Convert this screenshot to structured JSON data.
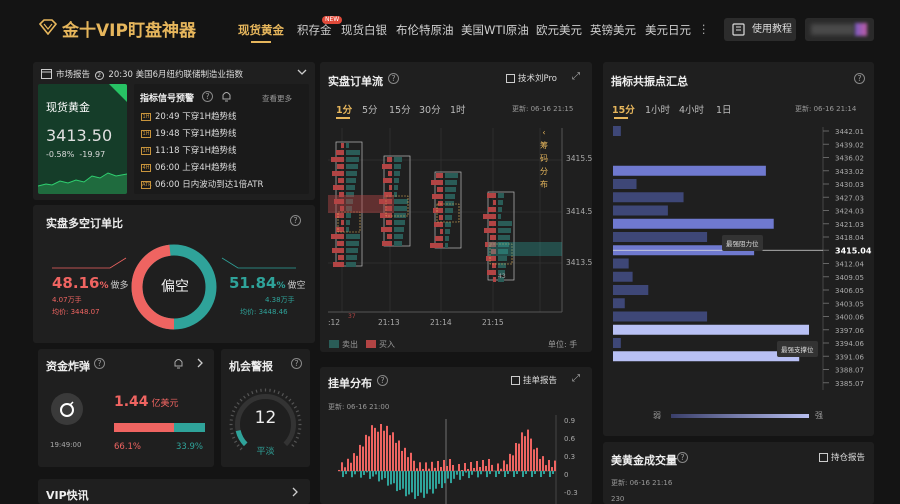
{
  "header": {
    "logo_text": "金十VIP盯盘神器",
    "nav": [
      "现货黄金",
      "积存金",
      "现货白银",
      "布伦特原油",
      "美国WTI原油",
      "欧元美元",
      "英镑美元",
      "美元日元"
    ],
    "new_badge": "NEW",
    "more": "⋮",
    "tutorial": "使用教程"
  },
  "market_report": {
    "label": "市场报告",
    "time_text": "20:30 美国6月纽约联储制造业指数"
  },
  "gold": {
    "name": "现货黄金",
    "price": "3413.50",
    "change_pct": "-0.58%",
    "change": "-19.97"
  },
  "signals": {
    "title": "指标信号预警",
    "more": "查看更多",
    "items": [
      {
        "icon": "1H",
        "time": "20:49",
        "text": "下穿1H趋势线"
      },
      {
        "icon": "1H",
        "time": "19:48",
        "text": "下穿1H趋势线"
      },
      {
        "icon": "1H",
        "time": "11:18",
        "text": "下穿1H趋势线"
      },
      {
        "icon": "4H",
        "time": "06:00",
        "text": "上穿4H趋势线"
      },
      {
        "icon": "ATR",
        "time": "06:00",
        "text": "日内波动到达1倍ATR"
      }
    ]
  },
  "longshort": {
    "title": "实盘多空订单比",
    "left_pct": "48.16",
    "left_unit": "%",
    "left_label": "做多",
    "left_vol": "4.07万手",
    "left_avg": "均价: 3448.07",
    "center": "偏空",
    "right_pct": "51.84",
    "right_unit": "%",
    "right_label": "做空",
    "right_vol": "4.38万手",
    "right_avg": "均价: 3448.46",
    "long_share": 0.4816,
    "color_long": "#ef6461",
    "color_short": "#2fa39a"
  },
  "fund_bomb": {
    "title": "资金炸弹",
    "amount": "1.44",
    "unit": "亿美元",
    "time": "19:49:00",
    "pct_left": "66.1%",
    "pct_right": "33.9%",
    "left_share": 0.661
  },
  "opportunity": {
    "title": "机会警报",
    "value": "12",
    "label": "平淡",
    "level": 0.12
  },
  "vip_news": {
    "title": "VIP快讯"
  },
  "orderflow": {
    "title": "实盘订单流",
    "pro": "技术刘Pro",
    "tabs": [
      "1分",
      "5分",
      "15分",
      "30分",
      "1时"
    ],
    "updated": "更新: 06-16 21:15",
    "side_label": "筹码分布",
    "y_ticks": [
      "3415.5",
      "3414.5",
      "3413.5"
    ],
    "x_ticks": [
      ":12",
      "21:13",
      "21:14",
      "21:15"
    ],
    "legend_sell": "卖出",
    "legend_buy": "买入",
    "unit": "单位: 手",
    "col_bottoms": [
      "37",
      "",
      "43",
      ""
    ],
    "footer_nums": [
      "37",
      "43"
    ]
  },
  "resonance": {
    "title": "指标共振点汇总",
    "tabs": [
      "15分",
      "1小时",
      "4小时",
      "1日"
    ],
    "updated": "更新: 06-16 21:14",
    "prices": [
      "3442.01",
      "3439.02",
      "3436.02",
      "3433.02",
      "3430.03",
      "3427.03",
      "3424.03",
      "3421.03",
      "3418.04",
      "3415.04",
      "3412.04",
      "3409.05",
      "3406.05",
      "3403.05",
      "3400.06",
      "3397.06",
      "3394.06",
      "3391.06",
      "3388.07",
      "3385.07"
    ],
    "strengths": [
      0.04,
      0,
      0,
      0.78,
      0.12,
      0.36,
      0.28,
      0.82,
      0.48,
      0.72,
      0.08,
      0.1,
      0.18,
      0.06,
      0.48,
      1.0,
      0.04,
      0.95,
      0,
      0
    ],
    "current_price": "3415.04",
    "label_resist": "最强阻力位",
    "label_support": "最强支撑位",
    "weak": "弱",
    "strong": "强",
    "bar_color": "#6f79cf"
  },
  "order_dist": {
    "title": "挂单分布",
    "report": "挂单报告",
    "updated": "更新: 06-16 21:00",
    "y_ticks": [
      "0.9",
      "0.6",
      "0.3",
      "0",
      "-0.3"
    ]
  },
  "gold_volume": {
    "title": "美黄金成交量",
    "report": "持仓报告",
    "updated": "更新: 06-16 21:16",
    "y_tick": "230"
  }
}
